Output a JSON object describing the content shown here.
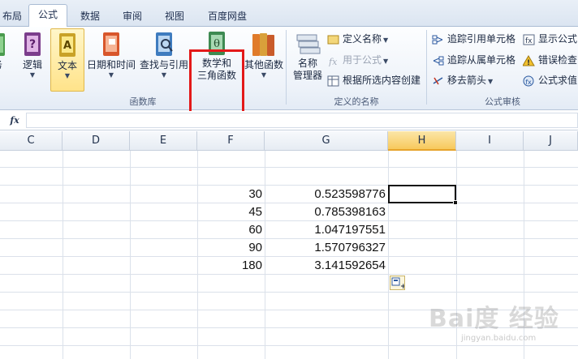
{
  "tabs": [
    {
      "label": "布局",
      "active": false
    },
    {
      "label": "公式",
      "active": true
    },
    {
      "label": "数据",
      "active": false
    },
    {
      "label": "审阅",
      "active": false
    },
    {
      "label": "视图",
      "active": false
    },
    {
      "label": "百度网盘",
      "active": false
    }
  ],
  "ribbon": {
    "function_library": {
      "group_label": "函数库",
      "buttons": [
        {
          "label": "务",
          "icon": "book-icon"
        },
        {
          "label": "逻辑",
          "icon": "logic-book-icon"
        },
        {
          "label": "文本",
          "icon": "text-book-icon",
          "highlighted": true
        },
        {
          "label": "日期和时间",
          "icon": "date-time-book-icon"
        },
        {
          "label": "查找与引用",
          "icon": "lookup-book-icon"
        },
        {
          "label_line1": "数学和",
          "label_line2": "三角函数",
          "icon": "math-trig-book-icon",
          "boxed": true
        },
        {
          "label": "其他函数",
          "icon": "more-functions-books-icon"
        }
      ]
    },
    "defined_names": {
      "group_label": "定义的名称",
      "name_manager_line1": "名称",
      "name_manager_line2": "管理器",
      "define_name": "定义名称",
      "use_in_formula": "用于公式",
      "create_from_selection": "根据所选内容创建"
    },
    "formula_auditing": {
      "group_label": "公式审核",
      "trace_precedents": "追踪引用单元格",
      "trace_dependents": "追踪从属单元格",
      "remove_arrows": "移去箭头",
      "show_formulas": "显示公式",
      "error_checking": "错误检查",
      "evaluate_formula": "公式求值"
    }
  },
  "formula_bar": {
    "fx": "fx",
    "value": ""
  },
  "grid": {
    "columns": [
      "C",
      "D",
      "E",
      "F",
      "G",
      "H",
      "I",
      "J"
    ],
    "selected_column": "H",
    "rows": [
      {
        "f": "30",
        "g": "0.523598776"
      },
      {
        "f": "45",
        "g": "0.785398163"
      },
      {
        "f": "60",
        "g": "1.047197551"
      },
      {
        "f": "90",
        "g": "1.570796327"
      },
      {
        "f": "180",
        "g": "3.141592654"
      }
    ]
  },
  "watermark": {
    "text": "Bai度 经验",
    "sub": "jingyan.baidu.com"
  },
  "colors": {
    "highlight_box": "#e31919",
    "selected_header": "#f7c95c",
    "ribbon_bg": "#edf2f9"
  }
}
